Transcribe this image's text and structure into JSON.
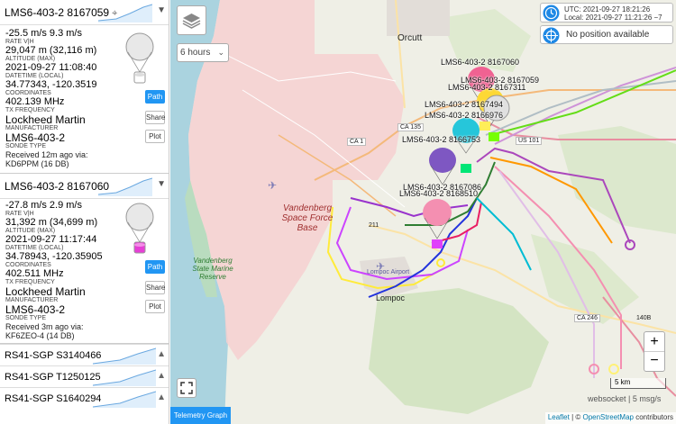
{
  "sidebar": {
    "sonde1": {
      "header": "LMS6-403-2 8167059",
      "rate": "-25.5 m/s 9.3 m/s",
      "rate_label": "RATE V|H",
      "altitude": "29,047 m (32,116 m)",
      "altitude_label": "ALTITUDE (MAX)",
      "datetime": "2021-09-27 11:08:40",
      "datetime_label": "DATETIME (LOCAL)",
      "coords": "34.77343, -120.3519",
      "coords_label": "COORDINATES",
      "freq": "402.139 MHz",
      "freq_label": "TX FREQUENCY",
      "manufacturer": "Lockheed Martin",
      "manufacturer_label": "MANUFACTURER",
      "type": "LMS6-403-2",
      "type_label": "SONDE TYPE",
      "received": "Received 12m ago via:",
      "via": "KD6PPM (16 DB)"
    },
    "sonde2_header": "LMS6-403-2 8167060",
    "sonde2": {
      "rate": "-27.8 m/s 2.9 m/s",
      "rate_label": "RATE V|H",
      "altitude": "31,392 m (34,699 m)",
      "altitude_label": "ALTITUDE (MAX)",
      "datetime": "2021-09-27 11:17:44",
      "datetime_label": "DATETIME (LOCAL)",
      "coords": "34.78943, -120.35905",
      "coords_label": "COORDINATES",
      "freq": "402.511 MHz",
      "freq_label": "TX FREQUENCY",
      "manufacturer": "Lockheed Martin",
      "manufacturer_label": "MANUFACTURER",
      "type": "LMS6-403-2",
      "type_label": "SONDE TYPE",
      "received": "Received 3m ago via:",
      "via": "KF6ZEO-4 (14 DB)"
    },
    "buttons": {
      "path": "Path",
      "share": "Share",
      "plot": "Plot"
    },
    "others": [
      "RS41-SGP S3140466",
      "RS41-SGP T1250125",
      "RS41-SGP S1640294"
    ]
  },
  "map": {
    "time_select": "6 hours",
    "utc": "UTC: 2021-09-27 18:21:26",
    "local": "Local: 2021-09-27 11:21:26 −7",
    "position_status": "No position available",
    "zoom_in": "+",
    "zoom_out": "−",
    "scale": "5 km",
    "websocket": "websocket | 5 msg/s",
    "telemetry_button": "Telemetry Graph",
    "attribution": {
      "leaflet": "Leaflet",
      "sep": " | © ",
      "osm": "OpenStreetMap",
      "contrib": " contributors"
    },
    "places": {
      "orcutt": "Orcutt",
      "lompoc": "Lompoc",
      "lompoc_airport": "Lompoc Airport",
      "vandenberg": "Vandenberg Space Force Base",
      "vsmr": "Vandenberg State Marine Reserve",
      "ca1": "CA 1",
      "ca135": "CA 135",
      "ca246": "CA 246",
      "us101": "US 101",
      "r211": "211",
      "r140b": "140B"
    },
    "sonde_labels": [
      "LMS6-403-2 8167060",
      "LMS6-403-2 8167059",
      "LMS6-403-2 8167311",
      "LMS6-403-2 8167494",
      "LMS6-403-2 8166976",
      "LMS6-403-2 8166753",
      "LMS6-403-2 8167086",
      "LMS6-403-2 8168510"
    ]
  },
  "colors": {
    "accent": "#2196f3",
    "water": "#aad3df",
    "restricted": "#f3c6c6",
    "land": "#efefe6"
  },
  "icons": [
    "layers-icon",
    "clock-icon",
    "compass-icon",
    "fullscreen-icon",
    "balloon-icon",
    "target-icon"
  ]
}
